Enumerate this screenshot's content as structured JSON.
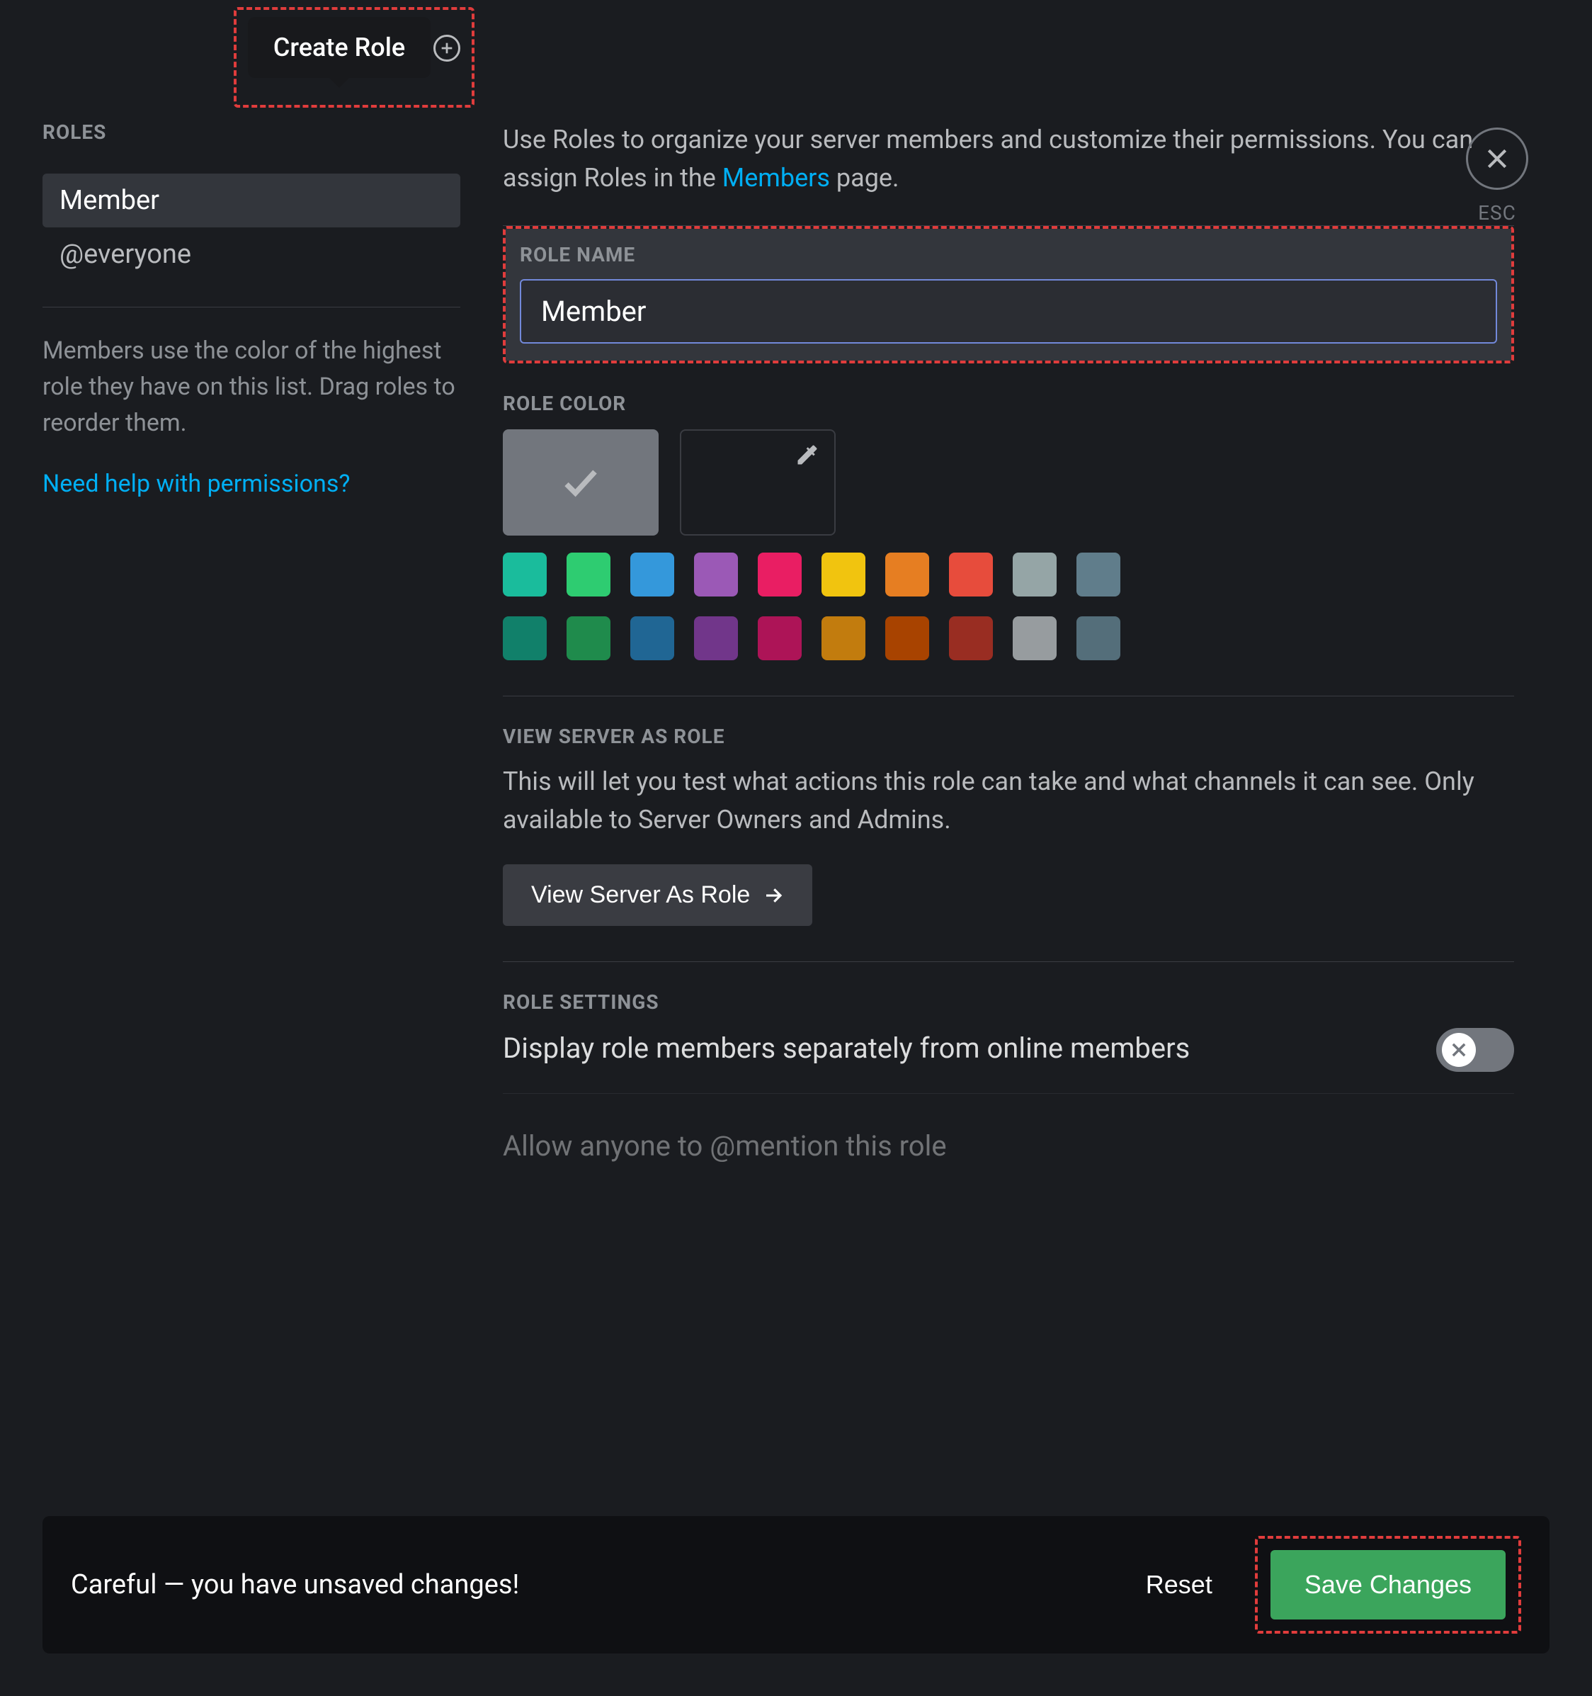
{
  "sidebar": {
    "title": "ROLES",
    "create_tooltip": "Create Role",
    "roles": [
      {
        "label": "Member",
        "selected": true
      },
      {
        "label": "@everyone",
        "selected": false
      }
    ],
    "help_text": "Members use the color of the highest role they have on this list. Drag roles to reorder them.",
    "help_link": "Need help with permissions?"
  },
  "close": {
    "esc": "ESC"
  },
  "main": {
    "intro_pre": "Use Roles to organize your server members and customize their permissions. You can assign Roles in the ",
    "intro_link": "Members",
    "intro_post": " page.",
    "role_name": {
      "label": "ROLE NAME",
      "value": "Member"
    },
    "role_color": {
      "label": "ROLE COLOR",
      "row1": [
        "#1abc9c",
        "#2ecc71",
        "#3498db",
        "#9b59b6",
        "#e91e63",
        "#f1c40f",
        "#e67e22",
        "#e74c3c",
        "#95a5a6",
        "#607d8b"
      ],
      "row2": [
        "#11806a",
        "#1f8b4c",
        "#206694",
        "#71368a",
        "#ad1457",
        "#c27c0e",
        "#a84300",
        "#992d22",
        "#979c9f",
        "#546e7a"
      ]
    },
    "view_as": {
      "label": "VIEW SERVER AS ROLE",
      "desc": "This will let you test what actions this role can take and what channels it can see. Only available to Server Owners and Admins.",
      "button": "View Server As Role"
    },
    "settings": {
      "label": "ROLE SETTINGS",
      "display_separately": "Display role members separately from online members",
      "mention_row": "Allow anyone to @mention this role"
    }
  },
  "unsaved": {
    "text": "Careful — you have unsaved changes!",
    "reset": "Reset",
    "save": "Save Changes"
  }
}
